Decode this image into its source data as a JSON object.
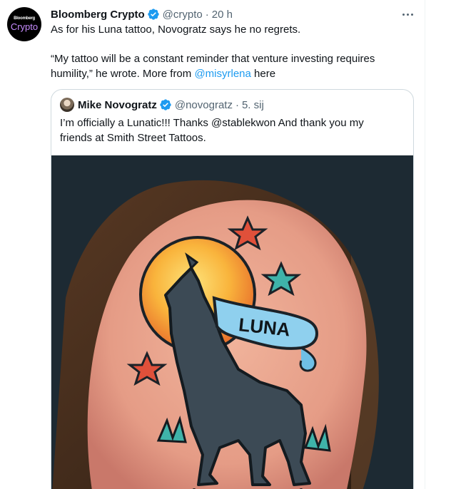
{
  "tweet": {
    "avatar": {
      "line1": "Bloomberg",
      "line2": "Crypto"
    },
    "display_name": "Bloomberg Crypto",
    "handle": "@crypto",
    "separator": "·",
    "time": "20 h",
    "text_line1": "As for his Luna tattoo, Novogratz says he no regrets.",
    "text_line2": "“My tattoo will be a constant reminder that venture investing requires",
    "text_line3_before": "humility,” he wrote. More from ",
    "text_line3_link": "@misyrlena",
    "text_line3_after": " here"
  },
  "quoted": {
    "display_name": "Mike Novogratz",
    "handle": "@novogratz",
    "separator": "·",
    "time": "5. sij",
    "text_line1": "I’m officially a Lunatic!!!  Thanks @stablekwon   And thank you my",
    "text_line2": "friends at Smith Street Tattoos.",
    "image": {
      "banner_text": "LUNA"
    }
  },
  "colors": {
    "link": "#1d9bf0",
    "verified": "#1d9bf0",
    "muted_text": "#536471",
    "border": "#cfd9de"
  }
}
